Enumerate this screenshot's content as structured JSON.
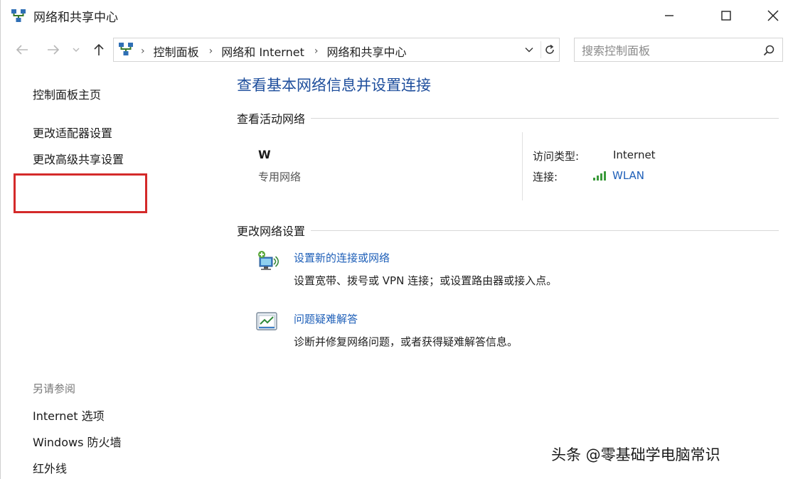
{
  "window": {
    "title": "网络和共享中心",
    "controls": {
      "minimize": "minimize",
      "maximize": "maximize",
      "close": "close"
    }
  },
  "nav": {
    "breadcrumbs": [
      "控制面板",
      "网络和 Internet",
      "网络和共享中心"
    ],
    "search_placeholder": "搜索控制面板"
  },
  "sidebar": {
    "home": "控制面板主页",
    "adapter_settings": "更改适配器设置",
    "advanced_sharing": "更改高级共享设置",
    "see_also_heading": "另请参阅",
    "see_also": [
      "Internet 选项",
      "Windows 防火墙",
      "红外线"
    ]
  },
  "main": {
    "title": "查看基本网络信息并设置连接",
    "active_networks_heading": "查看活动网络",
    "network": {
      "name": "W",
      "type": "专用网络",
      "access_type_label": "访问类型:",
      "access_type_value": "Internet",
      "connections_label": "连接:",
      "connection_name": "WLAN"
    },
    "change_settings_heading": "更改网络设置",
    "tasks": [
      {
        "link": "设置新的连接或网络",
        "desc": "设置宽带、拨号或 VPN 连接；或设置路由器或接入点。",
        "icon": "new-connection-icon"
      },
      {
        "link": "问题疑难解答",
        "desc": "诊断并修复网络问题，或者获得疑难解答信息。",
        "icon": "troubleshoot-icon"
      }
    ]
  },
  "watermark": "头条 @零基础学电脑常识",
  "colors": {
    "link": "#1e5fb8",
    "title": "#1e4e9c",
    "highlight": "#d42a2a"
  }
}
